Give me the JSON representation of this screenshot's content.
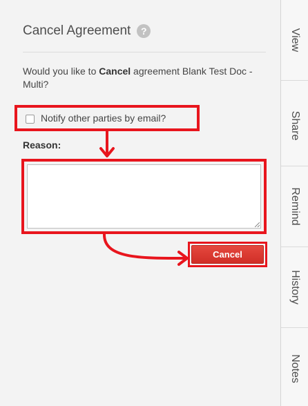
{
  "panel": {
    "title": "Cancel Agreement",
    "help_icon_glyph": "?",
    "question_prefix": "Would you like to ",
    "question_bold": "Cancel",
    "question_suffix": " agreement Blank Test Doc - Multi?",
    "notify_label": "Notify other parties by email?",
    "notify_checked": false,
    "reason_label": "Reason:",
    "reason_value": "",
    "cancel_label": "Cancel"
  },
  "tabs": [
    {
      "label": "View"
    },
    {
      "label": "Share"
    },
    {
      "label": "Remind"
    },
    {
      "label": "History"
    },
    {
      "label": "Notes"
    }
  ],
  "colors": {
    "annotation": "#e8151d",
    "cancel_button": "#d9362e",
    "panel_bg": "#f3f3f3"
  },
  "icons": [
    "help-icon",
    "checkbox",
    "resize-grip-icon",
    "arrow-icon"
  ]
}
